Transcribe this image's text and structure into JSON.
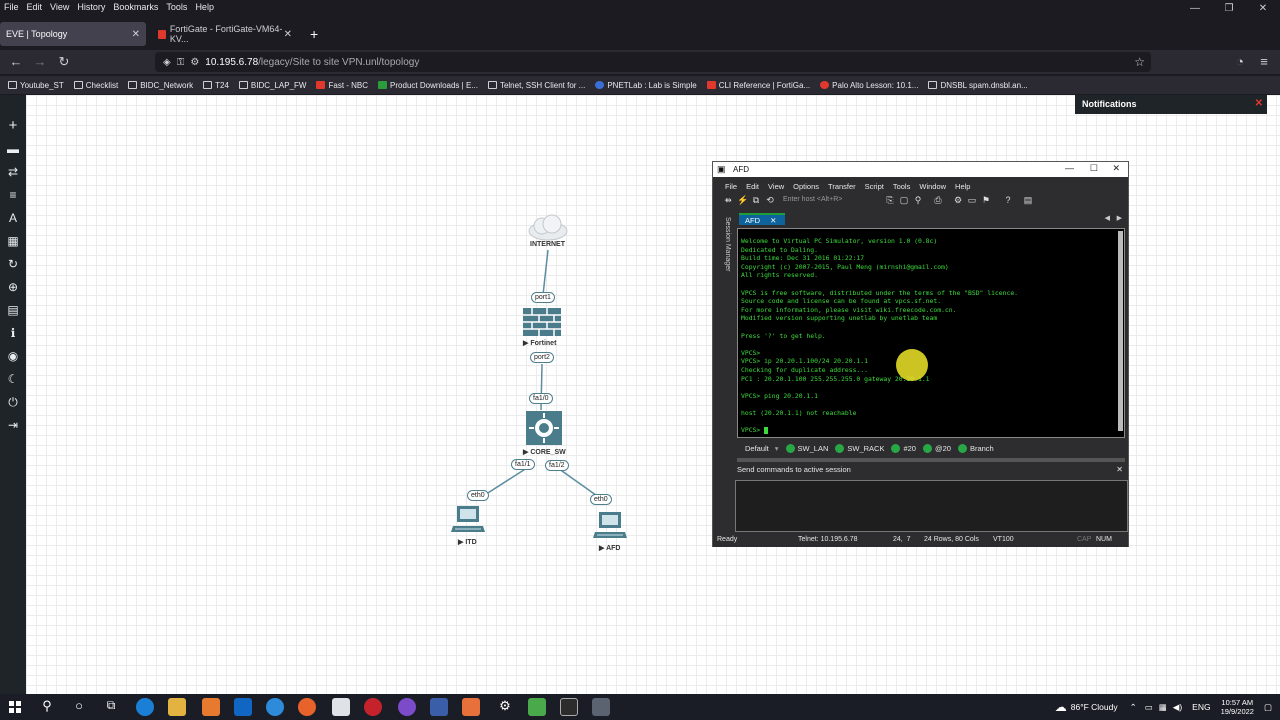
{
  "browser": {
    "menu": [
      "File",
      "Edit",
      "View",
      "History",
      "Bookmarks",
      "Tools",
      "Help"
    ],
    "tabs": [
      {
        "title": "EVE | Topology",
        "active": true
      },
      {
        "title": "FortiGate - FortiGate-VM64-KV...",
        "active": false
      }
    ],
    "new_tab_symbol": "+",
    "url_host": "10.195.6.78",
    "url_path": "/legacy/Site to site VPN.unl/topology",
    "bookmarks": [
      "Youtube_ST",
      "Checklist",
      "BIDC_Network",
      "T24",
      "BIDC_LAP_FW",
      "Fast - NBC",
      "Product Downloads | E...",
      "Telnet, SSH Client for ...",
      "PNETLab : Lab is Simple",
      "CLI Reference | FortiGa...",
      "Palo Alto Lesson: 10.1...",
      "DNSBL spam.dnsbl.an..."
    ]
  },
  "eve": {
    "notifications_label": "Notifications",
    "nodes": {
      "internet": "INTERNET",
      "fortinet": "Fortinet",
      "core_sw": "CORE_SW",
      "itd": "ITD",
      "afd": "AFD"
    },
    "ports": {
      "fw_port1": "port1",
      "fw_port2": "port2",
      "sw_fa10": "fa1/0",
      "sw_fa11": "fa1/1",
      "sw_fa12": "fa1/2",
      "itd_eth0": "eth0",
      "afd_eth0": "eth0"
    },
    "node_arrow": "▶"
  },
  "securecrt": {
    "title": "AFD",
    "menu": [
      "File",
      "Edit",
      "View",
      "Options",
      "Transfer",
      "Script",
      "Tools",
      "Window",
      "Help"
    ],
    "host_placeholder": "Enter host <Alt+R>",
    "session_manager": "Session Manager",
    "active_tab": "AFD",
    "terminal_lines": [
      "Welcome to Virtual PC Simulator, version 1.0 (0.8c)",
      "Dedicated to Daling.",
      "Build time: Dec 31 2016 01:22:17",
      "Copyright (c) 2007-2015, Paul Meng (mirnshi@gmail.com)",
      "All rights reserved.",
      "",
      "VPCS is free software, distributed under the terms of the \"BSD\" licence.",
      "Source code and license can be found at vpcs.sf.net.",
      "For more information, please visit wiki.freecode.com.cn.",
      "Modified version supporting unetlab by unetlab team",
      "",
      "Press '?' to get help.",
      "",
      "VPCS>",
      "VPCS> ip 20.20.1.100/24 20.20.1.1",
      "Checking for duplicate address...",
      "PC1 : 20.20.1.100 255.255.255.0 gateway 20.20.1.1",
      "",
      "VPCS> ping 20.20.1.1",
      "",
      "host (20.20.1.1) not reachable",
      "",
      "VPCS> "
    ],
    "session_tabs": {
      "default": "Default",
      "items": [
        "SW_LAN",
        "SW_RACK",
        "#20",
        "@20",
        "Branch"
      ]
    },
    "send_commands_label": "Send commands to active session",
    "status": {
      "ready": "Ready",
      "connection": "Telnet: 10.195.6.78",
      "position": "24,  7",
      "size": "24 Rows, 80 Cols",
      "terminal": "VT100",
      "caps": "CAP",
      "num": "NUM"
    }
  },
  "taskbar": {
    "weather": "86°F  Cloudy",
    "language": "ENG",
    "time": "10:57 AM",
    "date": "19/9/2022"
  }
}
